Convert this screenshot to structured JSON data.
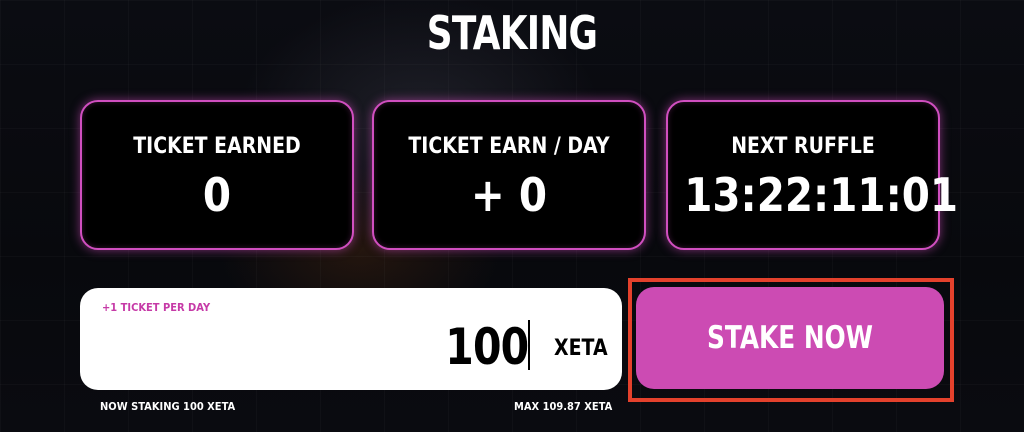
{
  "page": {
    "title": "STAKING"
  },
  "stats": [
    {
      "label": "TICKET EARNED",
      "value": "0"
    },
    {
      "label": "TICKET EARN / DAY",
      "value": "+ 0"
    },
    {
      "label": "NEXT RUFFLE",
      "value": "13:22:11:01"
    }
  ],
  "stake_input": {
    "hint": "+1 TICKET PER DAY",
    "amount": "100",
    "unit": "XETA"
  },
  "info": {
    "now_staking": "NOW STAKING 100 XETA",
    "max": "MAX 109.87 XETA"
  },
  "stake_button": {
    "label": "STAKE NOW"
  },
  "colors": {
    "accent": "#cc4bb3",
    "card_border": "#d14fc0",
    "highlight": "#e4412c",
    "hint": "#c63aa7"
  }
}
